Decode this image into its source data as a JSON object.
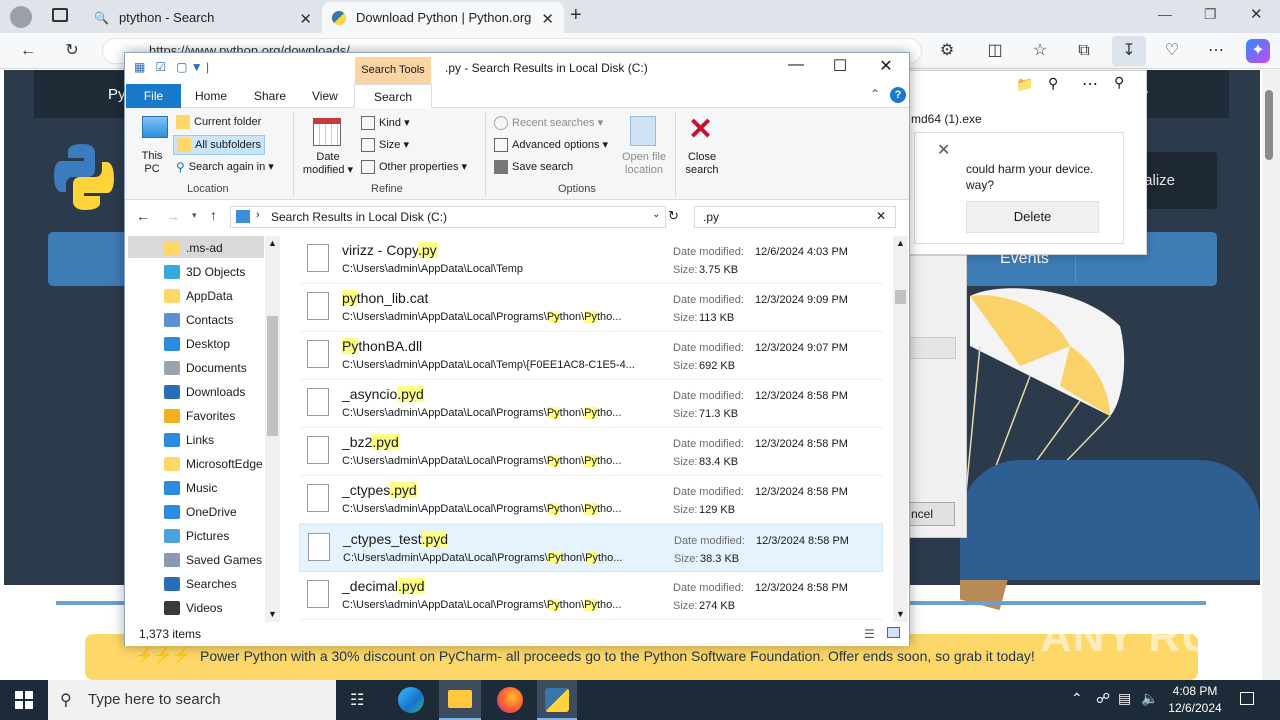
{
  "browser": {
    "tabs": [
      {
        "title": "ptython - Search",
        "icon": "search-icon"
      },
      {
        "title": "Download Python | Python.org",
        "icon": "python-icon"
      }
    ],
    "url": "https://www.python.org/downloads/"
  },
  "python_page": {
    "nav_visible": "Py",
    "community": "nity",
    "socialize": "Socialize",
    "events": "Events",
    "promo": "Power Python with a 30% discount on PyCharm- all proceeds go to the Python Software Foundation. Offer ends soon, so grab it today!"
  },
  "downloads_panel": {
    "filename": "md64 (1).exe",
    "warning": "could harm your device. way?",
    "delete_label": "Delete",
    "cancel_label": "ncel"
  },
  "explorer": {
    "title": ".py - Search Results in Local Disk (C:)",
    "context_tab": "Search Tools",
    "ribbon_tabs": {
      "file": "File",
      "home": "Home",
      "share": "Share",
      "view": "View",
      "search": "Search"
    },
    "ribbon": {
      "this_pc": "This PC",
      "current_folder": "Current folder",
      "all_subfolders": "All subfolders",
      "search_again": "Search again in",
      "location": "Location",
      "date_modified": "Date modified",
      "kind": "Kind",
      "size": "Size",
      "other_properties": "Other properties",
      "refine": "Refine",
      "recent_searches": "Recent searches",
      "advanced_options": "Advanced options",
      "save_search": "Save search",
      "open_file_location": "Open file location",
      "options": "Options",
      "close_search": "Close search"
    },
    "address": "Search Results in Local Disk (C:)",
    "search_query": ".py",
    "nav_items": [
      ".ms-ad",
      "3D Objects",
      "AppData",
      "Contacts",
      "Desktop",
      "Documents",
      "Downloads",
      "Favorites",
      "Links",
      "MicrosoftEdge",
      "Music",
      "OneDrive",
      "Pictures",
      "Saved Games",
      "Searches",
      "Videos"
    ],
    "date_label": "Date modified:",
    "size_label": "Size:",
    "results": [
      {
        "pre": "virizz - Copy",
        "hit": ".py",
        "post": "",
        "path": "C:\\Users\\admin\\AppData\\Local\\Temp",
        "date": "12/6/2024 4:03 PM",
        "size": "3.75 KB"
      },
      {
        "pre": "",
        "hit": "py",
        "post": "thon_lib.cat",
        "path": "C:\\Users\\admin\\AppData\\Local\\Programs\\Python\\Pytho...",
        "date": "12/3/2024 9:09 PM",
        "size": "113 KB"
      },
      {
        "pre": "",
        "hit": "Py",
        "post": "thonBA.dll",
        "path": "C:\\Users\\admin\\AppData\\Local\\Temp\\{F0EE1AC8-C1E5-4...",
        "date": "12/3/2024 9:07 PM",
        "size": "692 KB"
      },
      {
        "pre": "_asyncio",
        "hit": ".pyd",
        "post": "",
        "path": "C:\\Users\\admin\\AppData\\Local\\Programs\\Python\\Pytho...",
        "date": "12/3/2024 8:58 PM",
        "size": "71.3 KB"
      },
      {
        "pre": "_bz2",
        "hit": ".pyd",
        "post": "",
        "path": "C:\\Users\\admin\\AppData\\Local\\Programs\\Python\\Pytho...",
        "date": "12/3/2024 8:58 PM",
        "size": "83.4 KB"
      },
      {
        "pre": "_ctypes",
        "hit": ".pyd",
        "post": "",
        "path": "C:\\Users\\admin\\AppData\\Local\\Programs\\Python\\Pytho...",
        "date": "12/3/2024 8:58 PM",
        "size": "129 KB"
      },
      {
        "pre": "_ctypes_test",
        "hit": ".pyd",
        "post": "",
        "path": "C:\\Users\\admin\\AppData\\Local\\Programs\\Python\\Pytho...",
        "date": "12/3/2024 8:58 PM",
        "size": "38.3 KB"
      },
      {
        "pre": "_decimal",
        "hit": ".pyd",
        "post": "",
        "path": "C:\\Users\\admin\\AppData\\Local\\Programs\\Python\\Pytho...",
        "date": "12/3/2024 8:58 PM",
        "size": "274 KB"
      }
    ],
    "status": "1,373 items"
  },
  "taskbar": {
    "search_placeholder": "Type here to search",
    "time": "4:08 PM",
    "date": "12/6/2024"
  },
  "watermark": "ANY RUN"
}
